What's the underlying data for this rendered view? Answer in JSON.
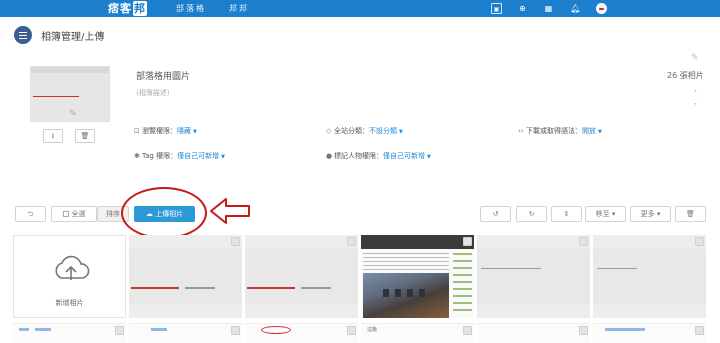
{
  "nav": {
    "logo_text": "痞客邦",
    "links": [
      "部落格",
      "邦邦"
    ]
  },
  "header": {
    "title": "相簿管理/上傳"
  },
  "album": {
    "name": "部落格用圖片",
    "description": "(相簿描述)",
    "photo_count": "26 張相片",
    "permissions": [
      {
        "label": "瀏覽權限：",
        "value": "隱藏"
      },
      {
        "label": "全站分類：",
        "value": "不設分類"
      },
      {
        "label": "下載或取得語法：",
        "value": "開放"
      },
      {
        "label": "Tag 權限：",
        "value": "僅自己可新增"
      },
      {
        "label": "標記人物權限：",
        "value": "僅自己可新增"
      }
    ]
  },
  "toolbar": {
    "select_all": "全選",
    "sort": "排序",
    "upload": "上傳相片",
    "move": "移至",
    "more": "更多"
  },
  "grid": {
    "new_photo": "新增相片",
    "lower_caption": "這篇"
  },
  "colors": {
    "nav_bg": "#1b7fce",
    "accent": "#1e88d8",
    "upload_btn": "#2d9ad8",
    "annotation": "#c41a1a"
  },
  "icons": [
    "menu-icon",
    "undo-icon",
    "rotate-left-icon",
    "rotate-right-icon",
    "expand-icon",
    "trash-icon",
    "download-icon",
    "bell-icon",
    "search-icon",
    "tag-icon",
    "lock-icon",
    "code-icon",
    "cloud-upload-icon",
    "pencil-icon"
  ]
}
